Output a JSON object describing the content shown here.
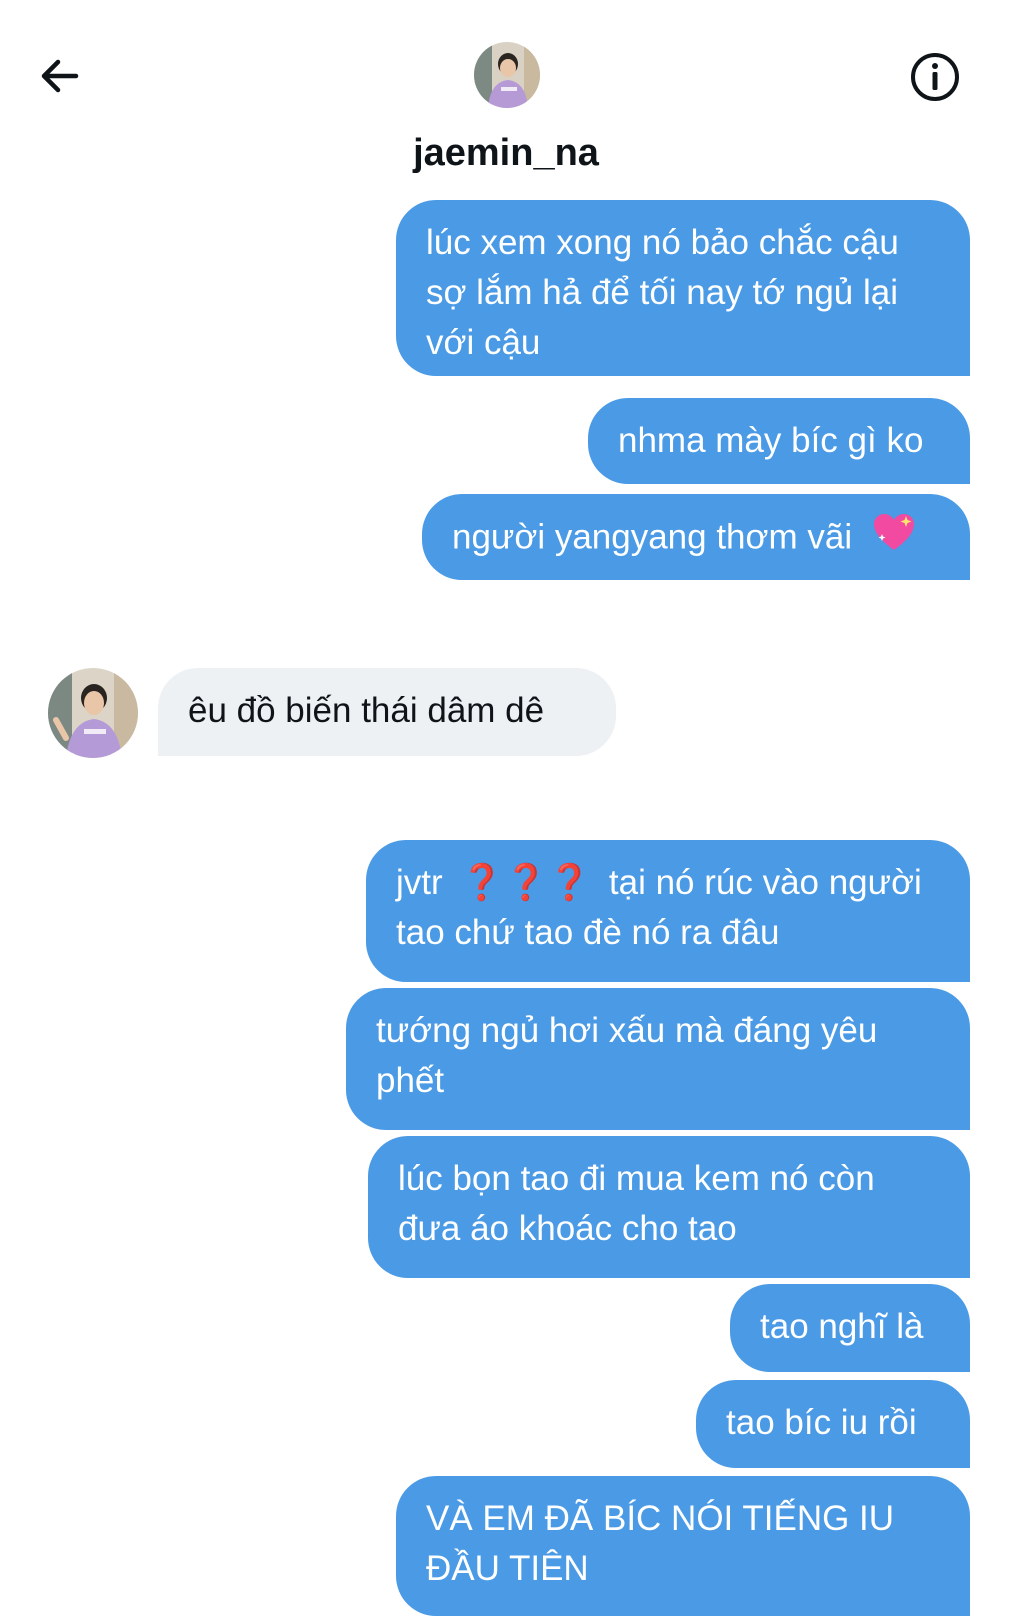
{
  "header": {
    "username": "jaemin_na",
    "back_icon": "arrow-left-icon",
    "info_icon": "info-circle-icon"
  },
  "messages": [
    {
      "side": "sent",
      "text": "lúc xem xong nó bảo chắc cậu sợ lắm hả để tối nay tớ ngủ lại với cậu"
    },
    {
      "side": "sent",
      "text": "nhma mày bíc gì ko"
    },
    {
      "side": "sent",
      "text": "người yangyang thơm vãi",
      "emoji": "sparkling-heart-icon"
    },
    {
      "side": "received",
      "text": "êu đồ biến thái dâm dê"
    },
    {
      "side": "sent",
      "prefix": "jvtr",
      "marks": "❓❓❓",
      "text": "tại nó rúc vào người tao chứ tao đè nó ra đâu"
    },
    {
      "side": "sent",
      "text": "tướng ngủ hơi xấu mà đáng yêu phết"
    },
    {
      "side": "sent",
      "text": "lúc bọn tao đi mua kem nó còn đưa áo khoác cho tao"
    },
    {
      "side": "sent",
      "text": "tao nghĩ là"
    },
    {
      "side": "sent",
      "text": "tao bíc iu rồi"
    },
    {
      "side": "sent",
      "text": "VÀ EM ĐÃ BÍC NÓI TIẾNG IU ĐẦU TIÊN"
    }
  ],
  "colors": {
    "sent_bubble": "#4a9ae6",
    "received_bubble": "#eef1f3"
  }
}
